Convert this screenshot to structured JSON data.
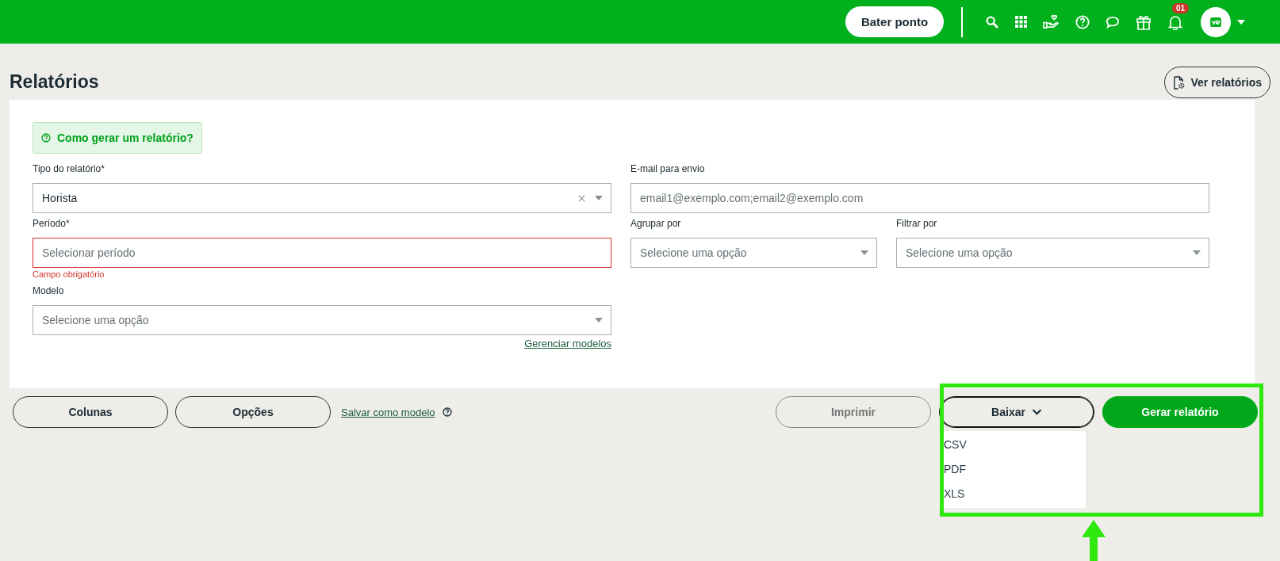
{
  "topbar": {
    "clock_button": "Bater ponto",
    "notification_count": "01"
  },
  "page": {
    "title": "Relatórios",
    "view_button": "Ver relatórios"
  },
  "help_banner": "Como gerar um relatório?",
  "form": {
    "report_type": {
      "label": "Tipo do relatório*",
      "value": "Horista",
      "clearable": true
    },
    "period": {
      "label": "Período*",
      "placeholder": "Selecionar período",
      "error": "Campo obrigatório"
    },
    "model": {
      "label": "Modelo",
      "placeholder": "Selecione uma opção"
    },
    "manage_link": "Gerenciar modelos",
    "email": {
      "label": "E-mail para envio",
      "placeholder": "email1@exemplo.com;email2@exemplo.com"
    },
    "group_by": {
      "label": "Agrupar por",
      "placeholder": "Selecione uma opção"
    },
    "filter_by": {
      "label": "Filtrar por",
      "placeholder": "Selecione uma opção"
    }
  },
  "actions": {
    "left": [
      "Colunas",
      "Opções"
    ],
    "save_link": "Salvar como modelo",
    "right": [
      {
        "kind": "outline",
        "label": "Imprimir",
        "disabled": true
      },
      {
        "kind": "dropdown",
        "label": "Baixar",
        "expanded": true,
        "options": [
          "CSV",
          "PDF",
          "XLS"
        ]
      },
      {
        "kind": "primary",
        "label": "Gerar relatório",
        "disabled": false
      }
    ]
  }
}
